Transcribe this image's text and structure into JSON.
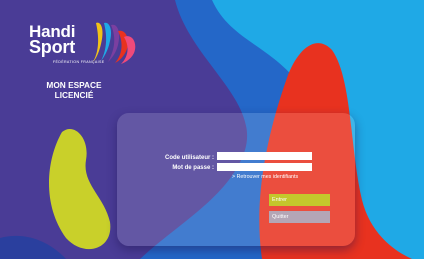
{
  "brand": {
    "line1": "Handi",
    "line2": "Sport",
    "subtitle": "FÉDÉRATION FRANÇAISE"
  },
  "space_title": {
    "line1": "MON ESPACE",
    "line2": "LICENCIÉ"
  },
  "login_form": {
    "username_label": "Code utilisateur :",
    "username_value": "",
    "password_label": "Mot de passe :",
    "password_value": "",
    "forgot_link": "> Retrouver mes identifiants",
    "enter_button": "Entrer",
    "quit_button": "Quitter"
  },
  "colors": {
    "background_purple": "#4a3c96",
    "background_blue": "#2467c8",
    "background_cyan": "#1fa9e6",
    "accent_red": "#e8321f",
    "accent_lime": "#c9d02a",
    "enter_button": "#c4c72c",
    "quit_button": "#b4a6b6"
  }
}
